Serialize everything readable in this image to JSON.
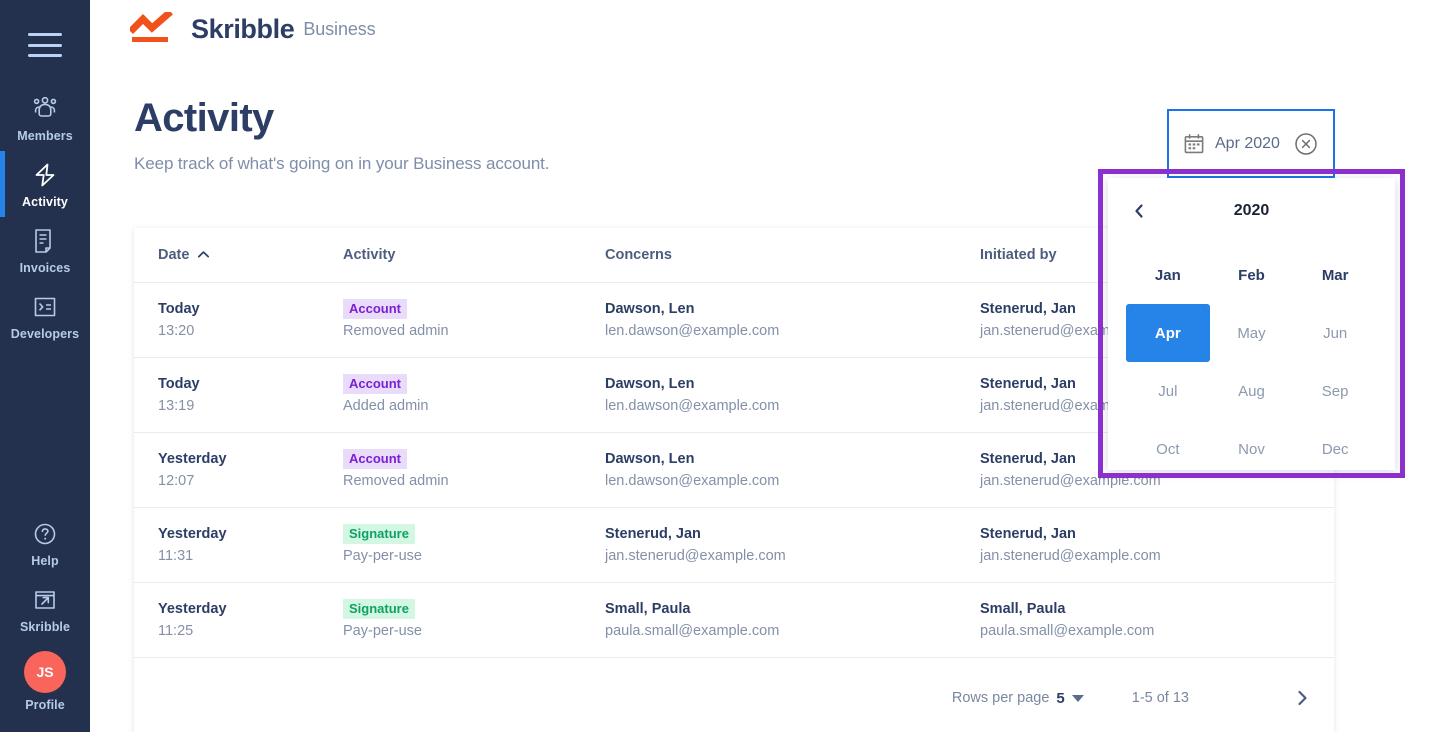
{
  "brand": {
    "name": "Skribble",
    "sub": "Business",
    "logo_color": "#f1511b"
  },
  "sidebar": {
    "menu_icon": "hamburger-icon",
    "items": [
      {
        "label": "Members",
        "icon": "members-icon",
        "active": false
      },
      {
        "label": "Activity",
        "icon": "activity-bolt-icon",
        "active": true
      },
      {
        "label": "Invoices",
        "icon": "invoice-document-icon",
        "active": false
      },
      {
        "label": "Developers",
        "icon": "terminal-code-icon",
        "active": false
      }
    ],
    "bottom_items": [
      {
        "label": "Help",
        "icon": "question-circle-icon"
      },
      {
        "label": "Skribble",
        "icon": "external-link-icon"
      }
    ],
    "profile": {
      "label": "Profile",
      "initials": "JS",
      "avatar_color": "#f9655b"
    },
    "active_indicator_color": "#2684e8",
    "background": "#23314f"
  },
  "page": {
    "title": "Activity",
    "subtitle": "Keep track of what's going on in your Business account."
  },
  "date_filter": {
    "icon": "calendar-icon",
    "value": "Apr 2020",
    "clear_icon": "close-circle-icon",
    "border_color": "#1a73e8"
  },
  "calendar": {
    "prev_icon": "chevron-left-icon",
    "year": "2020",
    "highlight_color": "#8b30cc",
    "selected_color": "#2684e8",
    "months": [
      {
        "label": "Jan",
        "state": "past"
      },
      {
        "label": "Feb",
        "state": "past"
      },
      {
        "label": "Mar",
        "state": "past"
      },
      {
        "label": "Apr",
        "state": "selected"
      },
      {
        "label": "May",
        "state": "normal"
      },
      {
        "label": "Jun",
        "state": "normal"
      },
      {
        "label": "Jul",
        "state": "normal"
      },
      {
        "label": "Aug",
        "state": "normal"
      },
      {
        "label": "Sep",
        "state": "normal"
      },
      {
        "label": "Oct",
        "state": "normal"
      },
      {
        "label": "Nov",
        "state": "normal"
      },
      {
        "label": "Dec",
        "state": "normal"
      }
    ]
  },
  "table": {
    "columns": [
      {
        "key": "date",
        "label": "Date",
        "sort": "asc",
        "sort_icon": "chevron-up-icon"
      },
      {
        "key": "activity",
        "label": "Activity"
      },
      {
        "key": "concerns",
        "label": "Concerns"
      },
      {
        "key": "initiated",
        "label": "Initiated by"
      }
    ],
    "rows": [
      {
        "date": "Today",
        "time": "13:20",
        "badge": "Account",
        "badge_type": "account",
        "activity_sub": "Removed admin",
        "concern_name": "Dawson, Len",
        "concern_email": "len.dawson@example.com",
        "initiator_name": "Stenerud, Jan",
        "initiator_email": "jan.stenerud@example.com"
      },
      {
        "date": "Today",
        "time": "13:19",
        "badge": "Account",
        "badge_type": "account",
        "activity_sub": "Added admin",
        "concern_name": "Dawson, Len",
        "concern_email": "len.dawson@example.com",
        "initiator_name": "Stenerud, Jan",
        "initiator_email": "jan.stenerud@example.com"
      },
      {
        "date": "Yesterday",
        "time": "12:07",
        "badge": "Account",
        "badge_type": "account",
        "activity_sub": "Removed admin",
        "concern_name": "Dawson, Len",
        "concern_email": "len.dawson@example.com",
        "initiator_name": "Stenerud, Jan",
        "initiator_email": "jan.stenerud@example.com"
      },
      {
        "date": "Yesterday",
        "time": "11:31",
        "badge": "Signature",
        "badge_type": "signature",
        "activity_sub": "Pay-per-use",
        "concern_name": "Stenerud, Jan",
        "concern_email": "jan.stenerud@example.com",
        "initiator_name": "Stenerud, Jan",
        "initiator_email": "jan.stenerud@example.com"
      },
      {
        "date": "Yesterday",
        "time": "11:25",
        "badge": "Signature",
        "badge_type": "signature",
        "activity_sub": "Pay-per-use",
        "concern_name": "Small, Paula",
        "concern_email": "paula.small@example.com",
        "initiator_name": "Small, Paula",
        "initiator_email": "paula.small@example.com"
      }
    ],
    "pager": {
      "rows_label": "Rows per page",
      "rows_value": "5",
      "dropdown_icon": "caret-down-icon",
      "range": "1-5 of 13",
      "next_icon": "chevron-right-icon"
    }
  }
}
